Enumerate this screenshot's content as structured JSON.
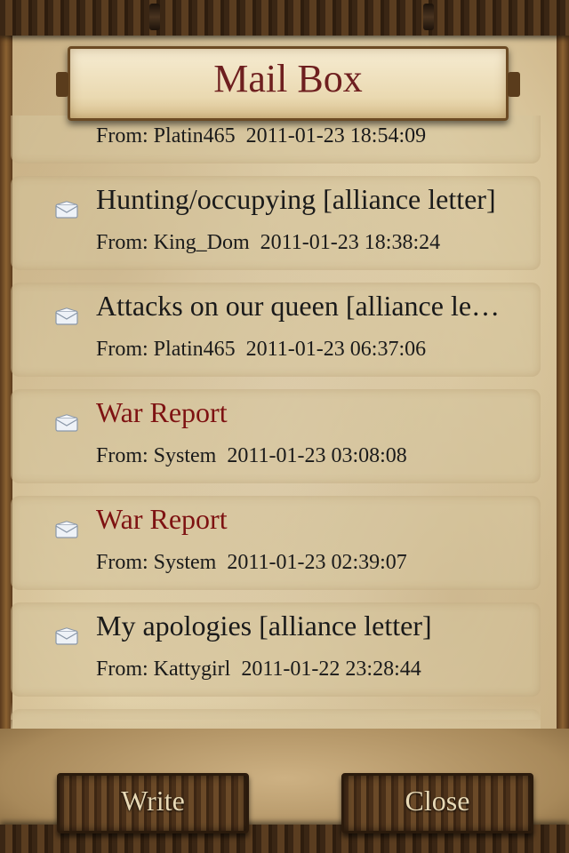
{
  "title": "Mail Box",
  "mails": [
    {
      "subject": "",
      "sender_line": "From: Platin465  2011-01-23 18:54:09",
      "system": false
    },
    {
      "subject": "Hunting/occupying [alliance letter]",
      "sender_line": "From: King_Dom  2011-01-23 18:38:24",
      "system": false
    },
    {
      "subject": "Attacks on our queen [alliance le…",
      "sender_line": "From: Platin465  2011-01-23 06:37:06",
      "system": false
    },
    {
      "subject": "War Report",
      "sender_line": "From: System  2011-01-23 03:08:08",
      "system": true
    },
    {
      "subject": "War Report",
      "sender_line": "From: System  2011-01-23 02:39:07",
      "system": true
    },
    {
      "subject": "My apologies [alliance letter]",
      "sender_line": "From: Kattygirl  2011-01-22 23:28:44",
      "system": false
    }
  ],
  "buttons": {
    "write": "Write",
    "close": "Close"
  },
  "colors": {
    "title": "#6e1f1f",
    "system_subject": "#7e1212",
    "normal_text": "#1a1a1a"
  },
  "icons": {
    "mail": "envelope-icon"
  }
}
